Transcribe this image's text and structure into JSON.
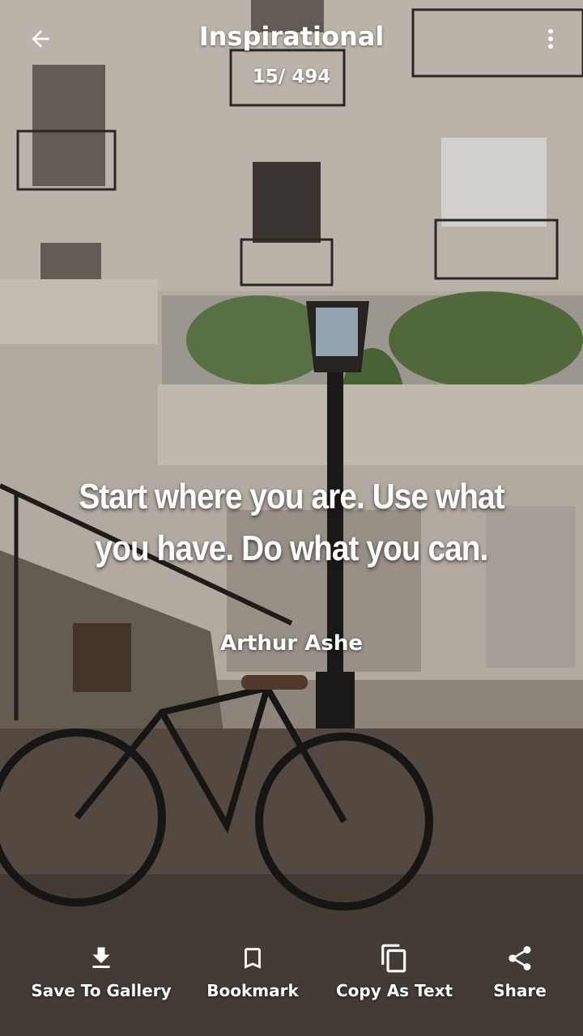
{
  "header": {
    "title": "Inspirational",
    "counter": "15/ 494",
    "back_icon": "arrow-left-icon",
    "menu_icon": "more-vertical-icon"
  },
  "quote": {
    "text": "Start where you are. Use what you have. Do what you can.",
    "author": "Arthur Ashe"
  },
  "actions": [
    {
      "label": "Save To Gallery",
      "icon": "download-icon"
    },
    {
      "label": "Bookmark",
      "icon": "bookmark-icon"
    },
    {
      "label": "Copy As Text",
      "icon": "copy-icon"
    },
    {
      "label": "Share",
      "icon": "share-icon"
    }
  ],
  "colors": {
    "text": "#ffffff"
  }
}
